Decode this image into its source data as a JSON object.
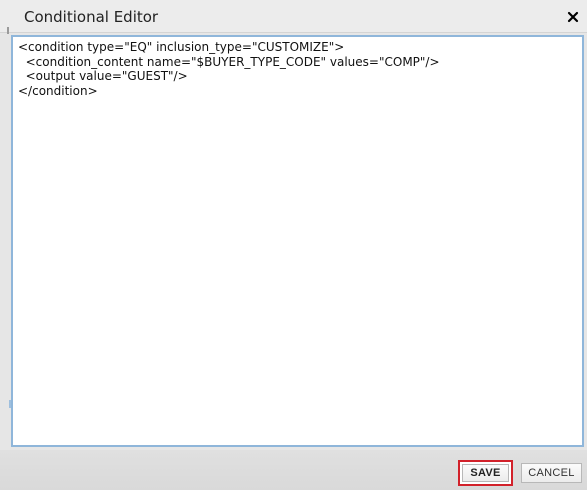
{
  "dialog": {
    "title": "Conditional Editor",
    "close_icon": "close-icon"
  },
  "editor": {
    "content": "<condition type=\"EQ\" inclusion_type=\"CUSTOMIZE\">\n  <condition_content name=\"$BUYER_TYPE_CODE\" values=\"COMP\"/>\n  <output value=\"GUEST\"/>\n</condition>"
  },
  "footer": {
    "save_label": "SAVE",
    "cancel_label": "CANCEL"
  },
  "colors": {
    "editor_border": "#8fb6da",
    "save_highlight": "#d2212a",
    "titlebar": "#ececec",
    "footer": "#dcdcdc"
  }
}
